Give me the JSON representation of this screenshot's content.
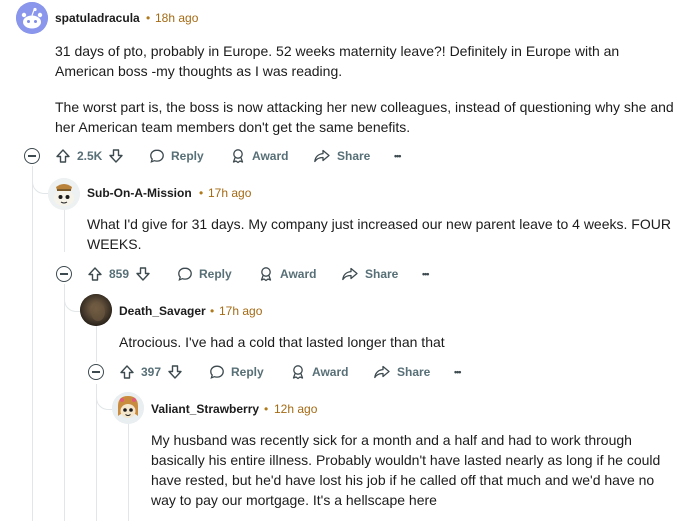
{
  "comments": [
    {
      "author": "spatuladracula",
      "timestamp": "18h ago",
      "paragraphs": [
        "31 days of pto, probably in Europe. 52 weeks maternity leave?! Definitely in Europe with an American boss -my thoughts as I was reading.",
        "The worst part is, the boss is now attacking her new colleagues, instead of questioning why she and her American team members don't get the same benefits."
      ],
      "votes": "2.5K"
    },
    {
      "author": "Sub-On-A-Mission",
      "timestamp": "17h ago",
      "paragraphs": [
        "What I'd give for 31 days. My company just increased our new parent leave to 4 weeks. FOUR WEEKS."
      ],
      "votes": "859"
    },
    {
      "author": "Death_Savager",
      "timestamp": "17h ago",
      "paragraphs": [
        "Atrocious. I've had a cold that lasted longer than that"
      ],
      "votes": "397"
    },
    {
      "author": "Valiant_Strawberry",
      "timestamp": "12h ago",
      "paragraphs": [
        "My husband was recently sick for a month and a half and had to work through basically his entire illness. Probably wouldn't have lasted nearly as long if he could have rested, but he'd have lost his job if he called off that much and we'd have no way to pay our mortgage. It's a hellscape here"
      ]
    }
  ],
  "actions": {
    "reply": "Reply",
    "award": "Award",
    "share": "Share",
    "more": "•••"
  },
  "separator": "•",
  "icons": [
    "collapse-icon",
    "upvote-icon",
    "downvote-icon",
    "reply-icon",
    "award-icon",
    "share-icon",
    "more-icon"
  ],
  "colors": {
    "timestamp": "#a46a14",
    "action_text": "#576f76",
    "thread_line": "#e2e6e8",
    "avatar_default": "#7e8ce6"
  }
}
